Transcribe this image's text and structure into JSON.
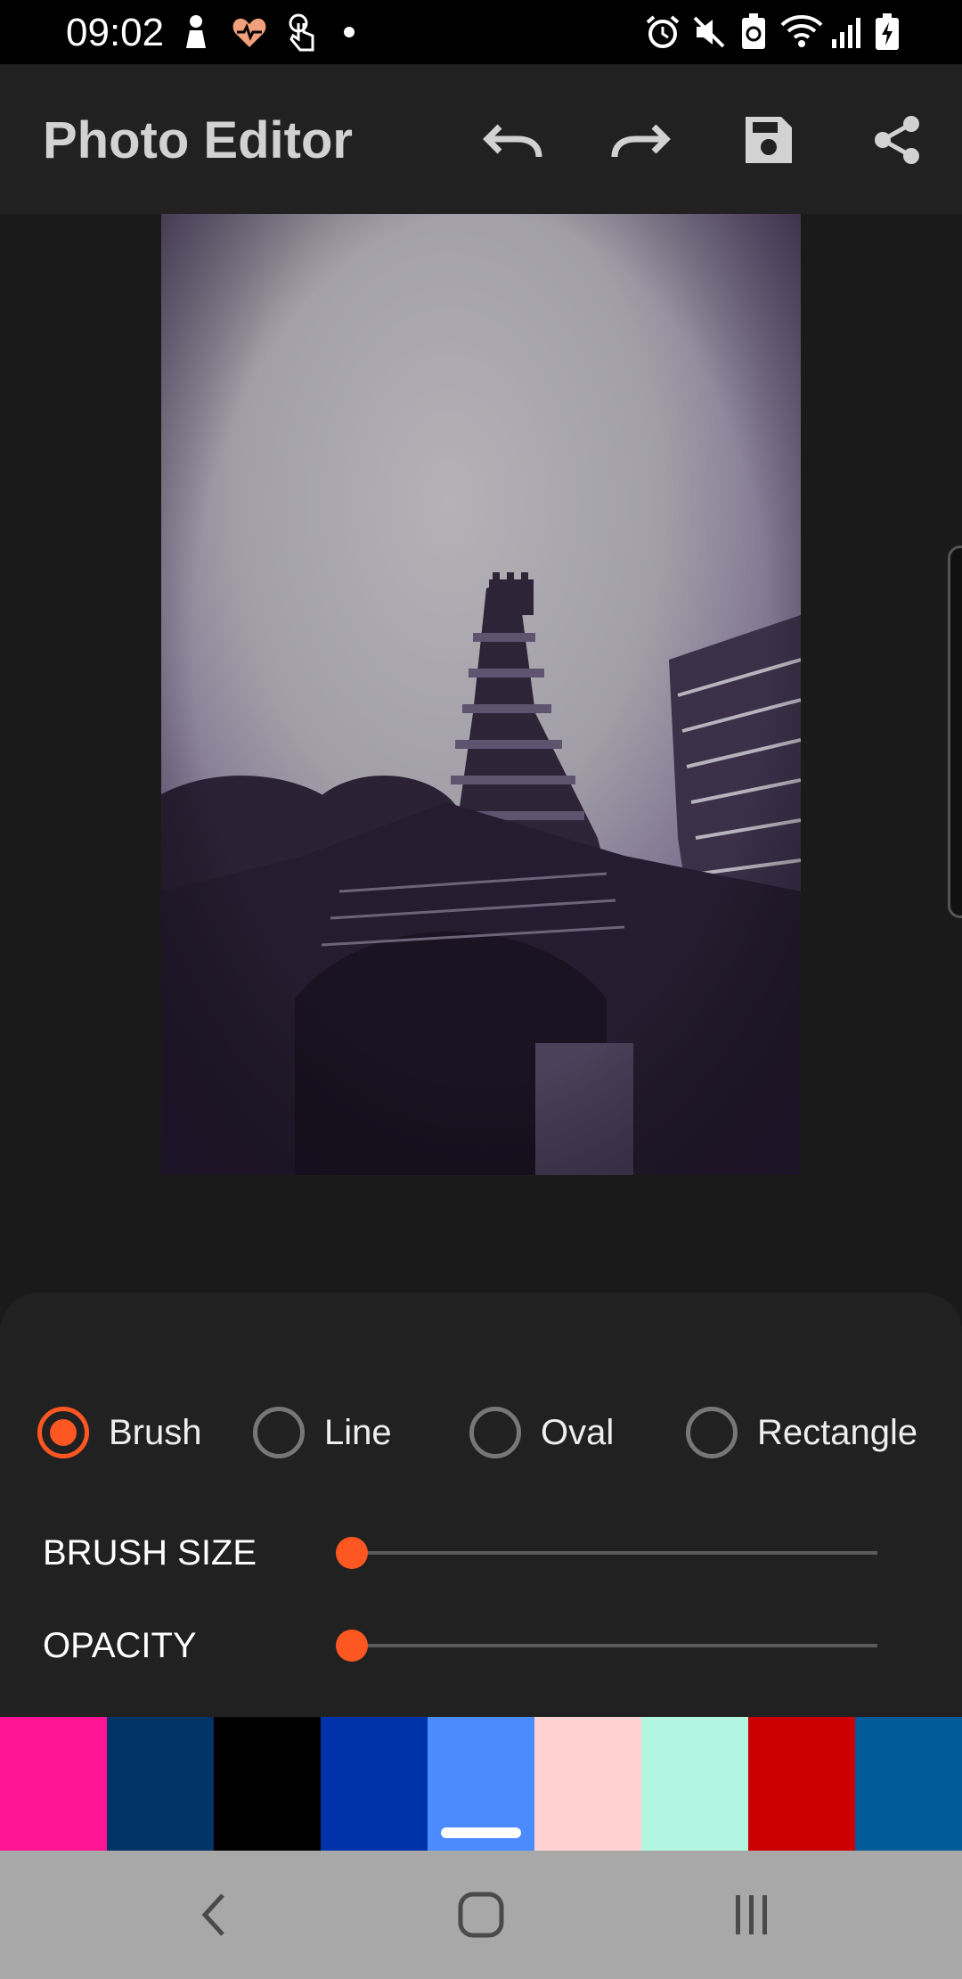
{
  "status_bar": {
    "time": "09:02",
    "left_icons": [
      "baby-icon",
      "heart-rate-icon",
      "touch-icon",
      "dot-icon"
    ],
    "right_icons": [
      "alarm-icon",
      "mute-icon",
      "battery-saver-icon",
      "wifi-icon",
      "signal-icon",
      "battery-charging-icon"
    ]
  },
  "app_bar": {
    "title": "Photo Editor",
    "actions": [
      "undo-icon",
      "redo-icon",
      "save-icon",
      "share-icon"
    ]
  },
  "tools": {
    "shapes": [
      {
        "label": "Brush",
        "selected": true
      },
      {
        "label": "Line",
        "selected": false
      },
      {
        "label": "Oval",
        "selected": false
      },
      {
        "label": "Rectangle",
        "selected": false
      }
    ],
    "brush_size": {
      "label": "BRUSH SIZE",
      "value_fraction": 0.0
    },
    "opacity": {
      "label": "OPACITY",
      "value_fraction": 0.0
    },
    "accent_color": "#ff5722"
  },
  "palette": {
    "colors": [
      "#ff1493",
      "#003366",
      "#000000",
      "#0033aa",
      "#4b8bff",
      "#ffd1d1",
      "#b2f5e0",
      "#cc0000",
      "#005b96"
    ],
    "selected_index": 4
  },
  "nav_bar": {
    "buttons": [
      "back-icon",
      "home-icon",
      "recents-icon"
    ]
  }
}
